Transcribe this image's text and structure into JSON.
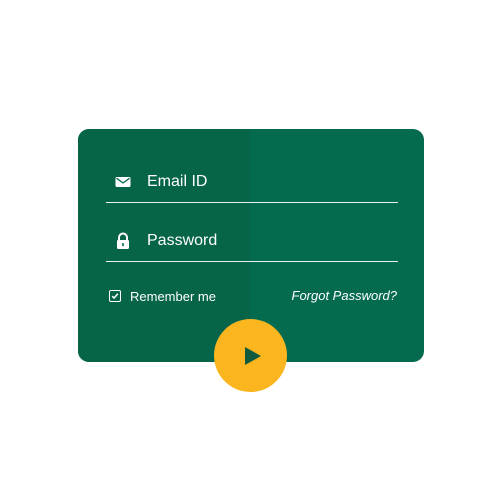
{
  "login": {
    "email_placeholder": "Email ID",
    "password_placeholder": "Password",
    "remember_label": "Remember me",
    "remember_checked": true,
    "forgot_label": "Forgot Password?"
  },
  "icons": {
    "email": "envelope-icon",
    "password": "lock-icon",
    "checkbox": "checkmark-icon",
    "submit": "play-icon"
  },
  "colors": {
    "card_background": "#056b4f",
    "card_shade": "#066449",
    "text": "#ffffff",
    "accent": "#fbb51e",
    "play_triangle": "#0f5a3f"
  }
}
